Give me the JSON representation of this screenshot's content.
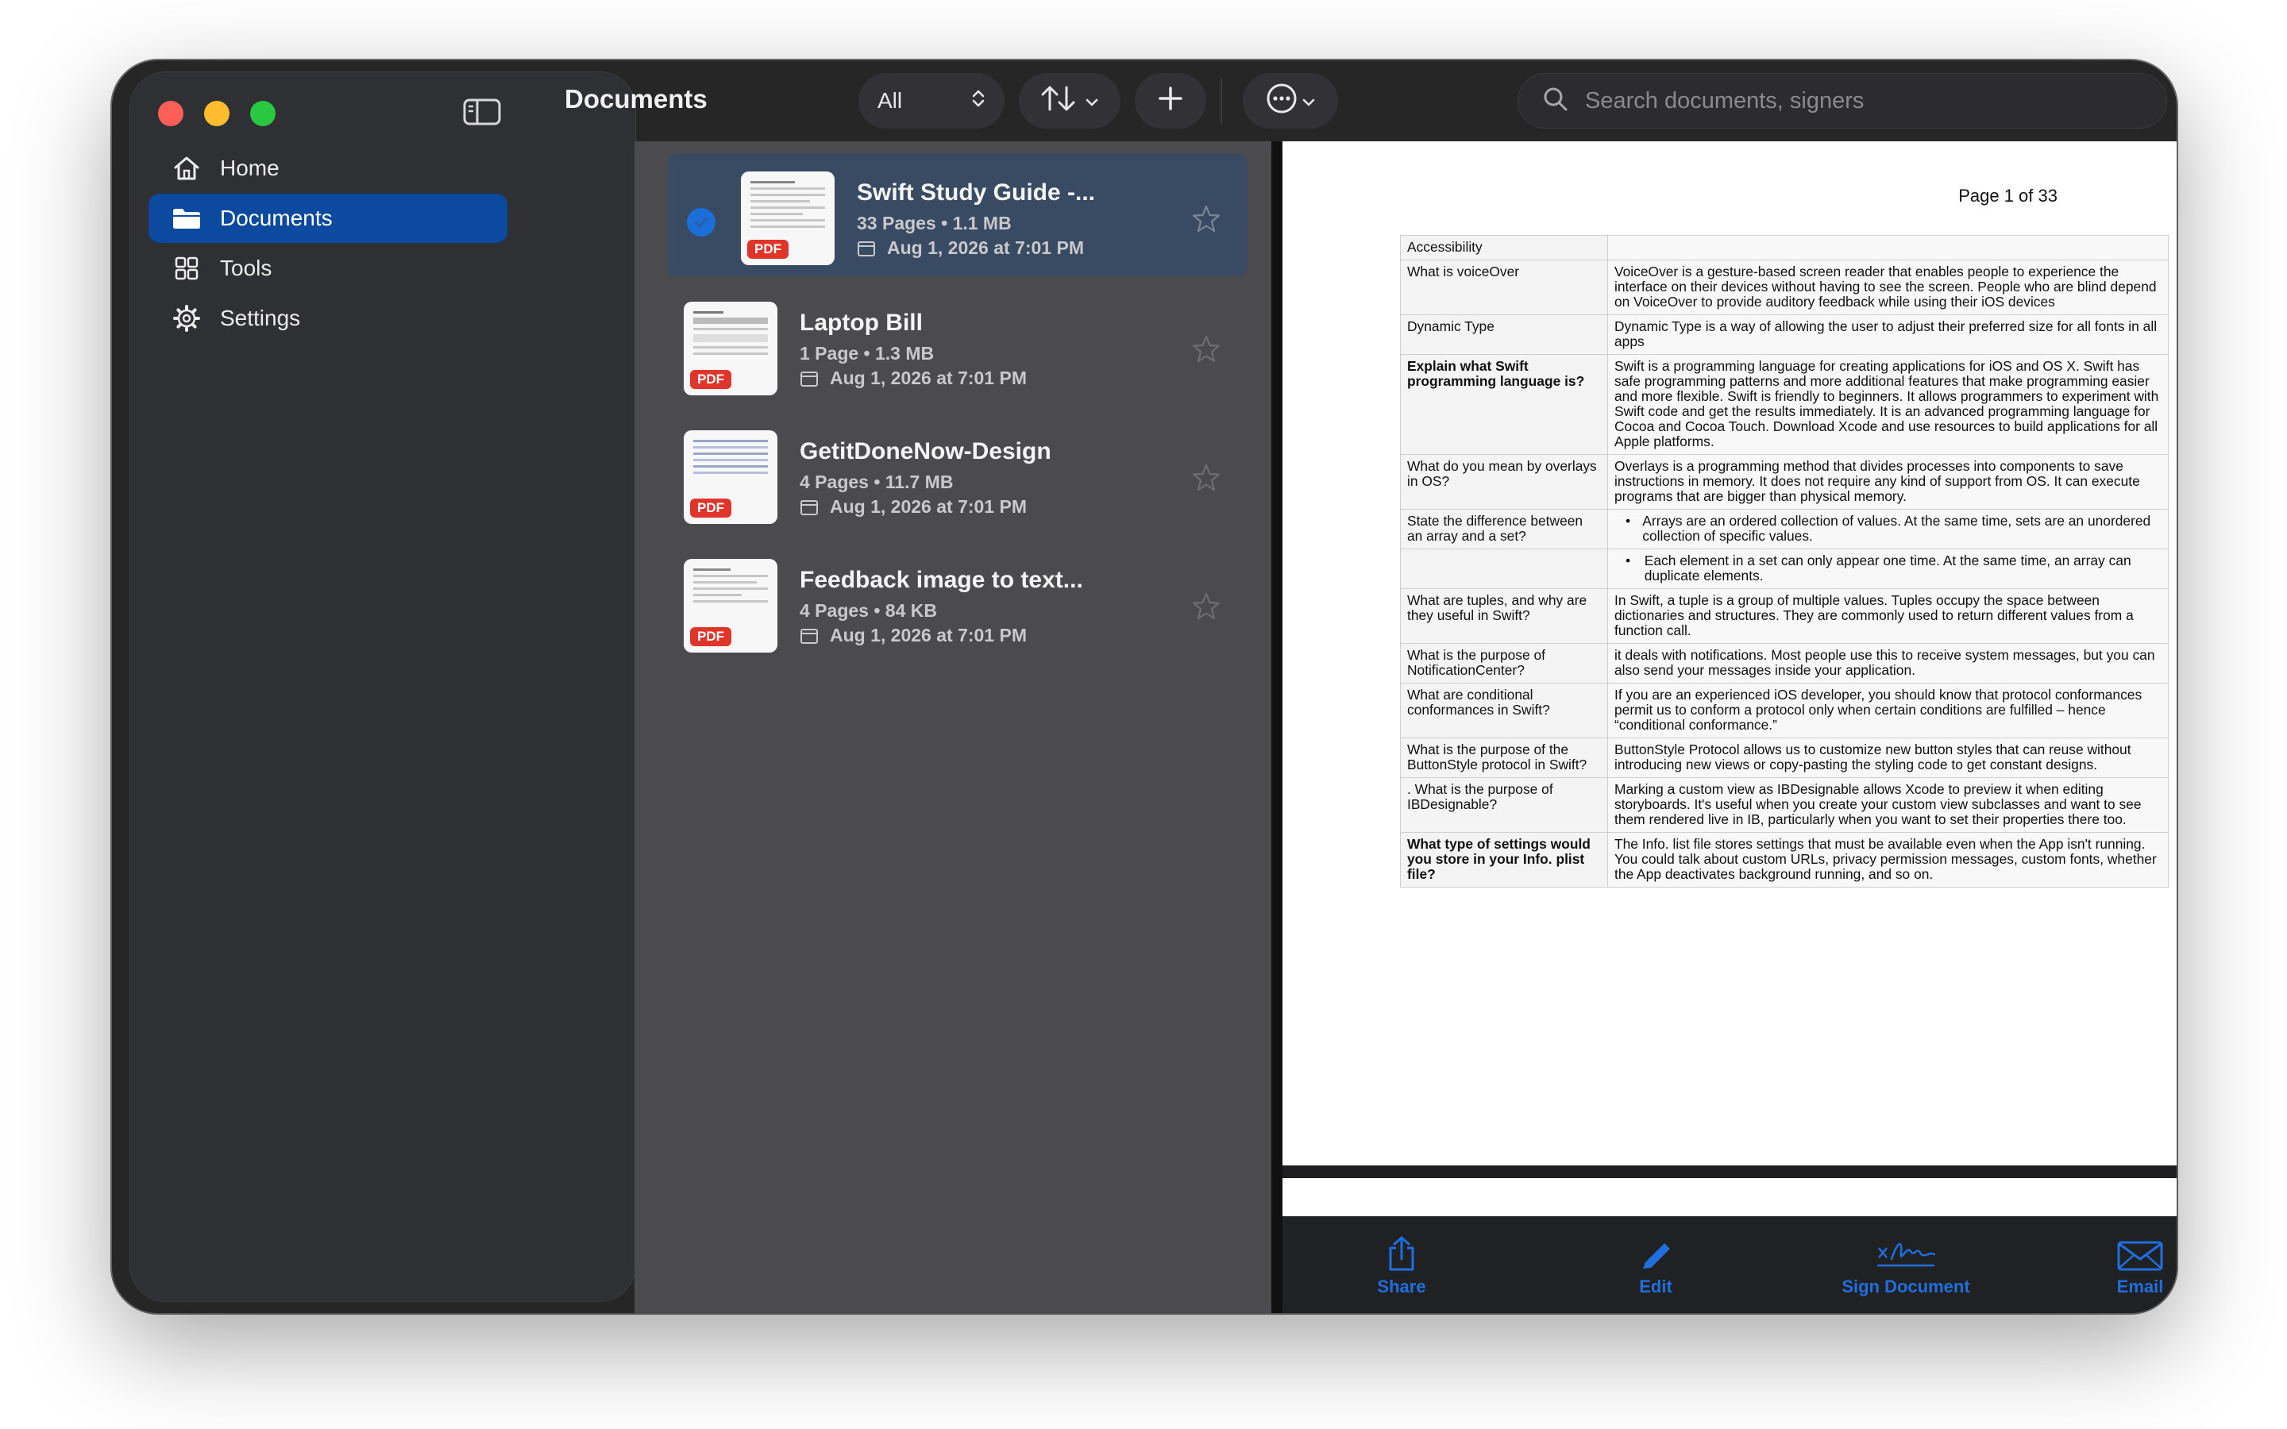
{
  "window": {
    "title": "Documents"
  },
  "sidebar": {
    "items": [
      {
        "label": "Home",
        "icon": "house-icon",
        "active": false
      },
      {
        "label": "Documents",
        "icon": "folder-icon",
        "active": true
      },
      {
        "label": "Tools",
        "icon": "grid-icon",
        "active": false
      },
      {
        "label": "Settings",
        "icon": "gear-icon",
        "active": false
      }
    ]
  },
  "toolbar": {
    "filter_value": "All",
    "search_placeholder": "Search documents, signers"
  },
  "documents": [
    {
      "title": "Swift Study Guide -...",
      "meta": "33 Pages • 1.1 MB",
      "date": "Aug 1, 2026 at 7:01 PM",
      "badge": "PDF",
      "selected": true
    },
    {
      "title": "Laptop Bill",
      "meta": "1 Page • 1.3 MB",
      "date": "Aug 1, 2026 at 7:01 PM",
      "badge": "PDF",
      "selected": false
    },
    {
      "title": "GetitDoneNow-Design",
      "meta": "4 Pages • 11.7 MB",
      "date": "Aug 1, 2026 at 7:01 PM",
      "badge": "PDF",
      "selected": false
    },
    {
      "title": "Feedback image to text...",
      "meta": "4 Pages • 84 KB",
      "date": "Aug 1, 2026 at 7:01 PM",
      "badge": "PDF",
      "selected": false
    }
  ],
  "viewer": {
    "page_label": "Page 1 of 33",
    "rows": [
      {
        "q": "Accessibility",
        "a": ""
      },
      {
        "q": "What is voiceOver",
        "a": "VoiceOver is a gesture-based screen reader that enables people to experience the interface on their devices without having to see the screen. People who are blind depend on VoiceOver to provide auditory feedback while using their iOS devices"
      },
      {
        "q": "Dynamic Type",
        "a": "Dynamic Type is a way of allowing the user to adjust their preferred size for all fonts in all apps"
      },
      {
        "q": "Explain what Swift programming language is?",
        "a": "Swift is a programming language for creating applications for iOS and OS X. Swift has safe programming patterns and more additional features that make programming easier and more flexible. Swift is friendly to beginners. It allows programmers to experiment with Swift code and get the results immediately. It is an advanced programming language for Cocoa and Cocoa Touch. Download Xcode and use resources to build applications for all Apple platforms."
      },
      {
        "q": " What do you mean by overlays in OS?",
        "a": "Overlays is a programming method that divides processes into components to save instructions in memory. It does not require any kind of support from OS. It can execute programs that are bigger than physical memory."
      },
      {
        "q": "State the difference between an array and a set?",
        "a": "Arrays are an ordered collection of values. At the same time, sets are an unordered collection of specific values."
      },
      {
        "q": "",
        "a": "Each element in a set can only appear one time. At the same time, an array can duplicate elements."
      },
      {
        "q": "What are tuples, and why are they useful in Swift?",
        "a": "In Swift, a tuple is a group of multiple values. Tuples occupy the space between dictionaries and structures. They are commonly used to return different values from a function call."
      },
      {
        "q": "What is the purpose of NotificationCenter?",
        "a": " it deals with notifications. Most people use this to receive system messages, but you can also send your messages inside your application."
      },
      {
        "q": " What are conditional conformances in Swift?",
        "a": "If you are an experienced iOS developer, you should know that protocol conformances permit us to conform a protocol only when certain conditions are fulfilled – hence “conditional conformance.”"
      },
      {
        "q": " What is the purpose of the ButtonStyle protocol in Swift?",
        "a": "ButtonStyle Protocol allows us to customize new button styles that can reuse without introducing new views or copy-pasting the styling code to get constant designs."
      },
      {
        "q": ". What is the purpose of IBDesignable?",
        "a": "Marking a custom view as IBDesignable allows Xcode to preview it when editing storyboards. It's useful when you create your custom view subclasses and want to see them rendered live in IB, particularly when you want to set their properties there too."
      },
      {
        "q": "What type of settings would you store in your Info. plist file?",
        "a": "The Info. list file stores settings that must be available even when the App isn't running. You could talk about custom URLs, privacy permission messages, custom fonts, whether the App deactivates background running, and so on."
      }
    ]
  },
  "bottom_bar": {
    "share": "Share",
    "edit": "Edit",
    "sign": "Sign Document",
    "email": "Email"
  },
  "colors": {
    "accent": "#1f6fe0",
    "sidebar_active": "#0b4a9e",
    "pdf_badge": "#e0352b"
  }
}
